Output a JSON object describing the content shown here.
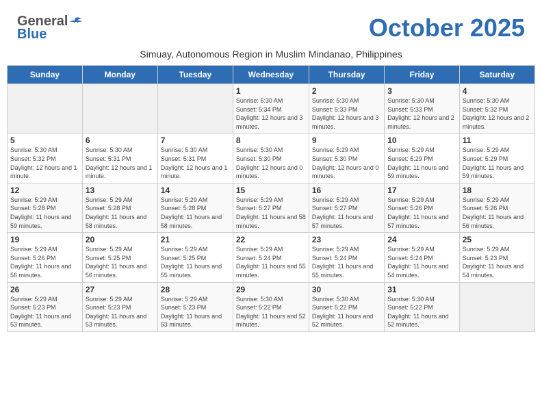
{
  "logo": {
    "general": "General",
    "blue": "Blue"
  },
  "title": "October 2025",
  "subtitle": "Simuay, Autonomous Region in Muslim Mindanao, Philippines",
  "weekdays": [
    "Sunday",
    "Monday",
    "Tuesday",
    "Wednesday",
    "Thursday",
    "Friday",
    "Saturday"
  ],
  "weeks": [
    [
      {
        "day": "",
        "info": ""
      },
      {
        "day": "",
        "info": ""
      },
      {
        "day": "",
        "info": ""
      },
      {
        "day": "1",
        "info": "Sunrise: 5:30 AM\nSunset: 5:34 PM\nDaylight: 12 hours and 3 minutes."
      },
      {
        "day": "2",
        "info": "Sunrise: 5:30 AM\nSunset: 5:33 PM\nDaylight: 12 hours and 3 minutes."
      },
      {
        "day": "3",
        "info": "Sunrise: 5:30 AM\nSunset: 5:33 PM\nDaylight: 12 hours and 2 minutes."
      },
      {
        "day": "4",
        "info": "Sunrise: 5:30 AM\nSunset: 5:32 PM\nDaylight: 12 hours and 2 minutes."
      }
    ],
    [
      {
        "day": "5",
        "info": "Sunrise: 5:30 AM\nSunset: 5:32 PM\nDaylight: 12 hours and 1 minute."
      },
      {
        "day": "6",
        "info": "Sunrise: 5:30 AM\nSunset: 5:31 PM\nDaylight: 12 hours and 1 minute."
      },
      {
        "day": "7",
        "info": "Sunrise: 5:30 AM\nSunset: 5:31 PM\nDaylight: 12 hours and 1 minute."
      },
      {
        "day": "8",
        "info": "Sunrise: 5:30 AM\nSunset: 5:30 PM\nDaylight: 12 hours and 0 minutes."
      },
      {
        "day": "9",
        "info": "Sunrise: 5:29 AM\nSunset: 5:30 PM\nDaylight: 12 hours and 0 minutes."
      },
      {
        "day": "10",
        "info": "Sunrise: 5:29 AM\nSunset: 5:29 PM\nDaylight: 11 hours and 59 minutes."
      },
      {
        "day": "11",
        "info": "Sunrise: 5:29 AM\nSunset: 5:29 PM\nDaylight: 11 hours and 59 minutes."
      }
    ],
    [
      {
        "day": "12",
        "info": "Sunrise: 5:29 AM\nSunset: 5:28 PM\nDaylight: 11 hours and 59 minutes."
      },
      {
        "day": "13",
        "info": "Sunrise: 5:29 AM\nSunset: 5:28 PM\nDaylight: 11 hours and 58 minutes."
      },
      {
        "day": "14",
        "info": "Sunrise: 5:29 AM\nSunset: 5:28 PM\nDaylight: 11 hours and 58 minutes."
      },
      {
        "day": "15",
        "info": "Sunrise: 5:29 AM\nSunset: 5:27 PM\nDaylight: 11 hours and 58 minutes."
      },
      {
        "day": "16",
        "info": "Sunrise: 5:29 AM\nSunset: 5:27 PM\nDaylight: 11 hours and 57 minutes."
      },
      {
        "day": "17",
        "info": "Sunrise: 5:29 AM\nSunset: 5:26 PM\nDaylight: 11 hours and 57 minutes."
      },
      {
        "day": "18",
        "info": "Sunrise: 5:29 AM\nSunset: 5:26 PM\nDaylight: 11 hours and 56 minutes."
      }
    ],
    [
      {
        "day": "19",
        "info": "Sunrise: 5:29 AM\nSunset: 5:26 PM\nDaylight: 11 hours and 56 minutes."
      },
      {
        "day": "20",
        "info": "Sunrise: 5:29 AM\nSunset: 5:25 PM\nDaylight: 11 hours and 56 minutes."
      },
      {
        "day": "21",
        "info": "Sunrise: 5:29 AM\nSunset: 5:25 PM\nDaylight: 11 hours and 55 minutes."
      },
      {
        "day": "22",
        "info": "Sunrise: 5:29 AM\nSunset: 5:24 PM\nDaylight: 11 hours and 55 minutes."
      },
      {
        "day": "23",
        "info": "Sunrise: 5:29 AM\nSunset: 5:24 PM\nDaylight: 11 hours and 55 minutes."
      },
      {
        "day": "24",
        "info": "Sunrise: 5:29 AM\nSunset: 5:24 PM\nDaylight: 11 hours and 54 minutes."
      },
      {
        "day": "25",
        "info": "Sunrise: 5:29 AM\nSunset: 5:23 PM\nDaylight: 11 hours and 54 minutes."
      }
    ],
    [
      {
        "day": "26",
        "info": "Sunrise: 5:29 AM\nSunset: 5:23 PM\nDaylight: 11 hours and 53 minutes."
      },
      {
        "day": "27",
        "info": "Sunrise: 5:29 AM\nSunset: 5:23 PM\nDaylight: 11 hours and 53 minutes."
      },
      {
        "day": "28",
        "info": "Sunrise: 5:29 AM\nSunset: 5:23 PM\nDaylight: 11 hours and 53 minutes."
      },
      {
        "day": "29",
        "info": "Sunrise: 5:30 AM\nSunset: 5:22 PM\nDaylight: 11 hours and 52 minutes."
      },
      {
        "day": "30",
        "info": "Sunrise: 5:30 AM\nSunset: 5:22 PM\nDaylight: 11 hours and 52 minutes."
      },
      {
        "day": "31",
        "info": "Sunrise: 5:30 AM\nSunset: 5:22 PM\nDaylight: 11 hours and 52 minutes."
      },
      {
        "day": "",
        "info": ""
      }
    ]
  ]
}
